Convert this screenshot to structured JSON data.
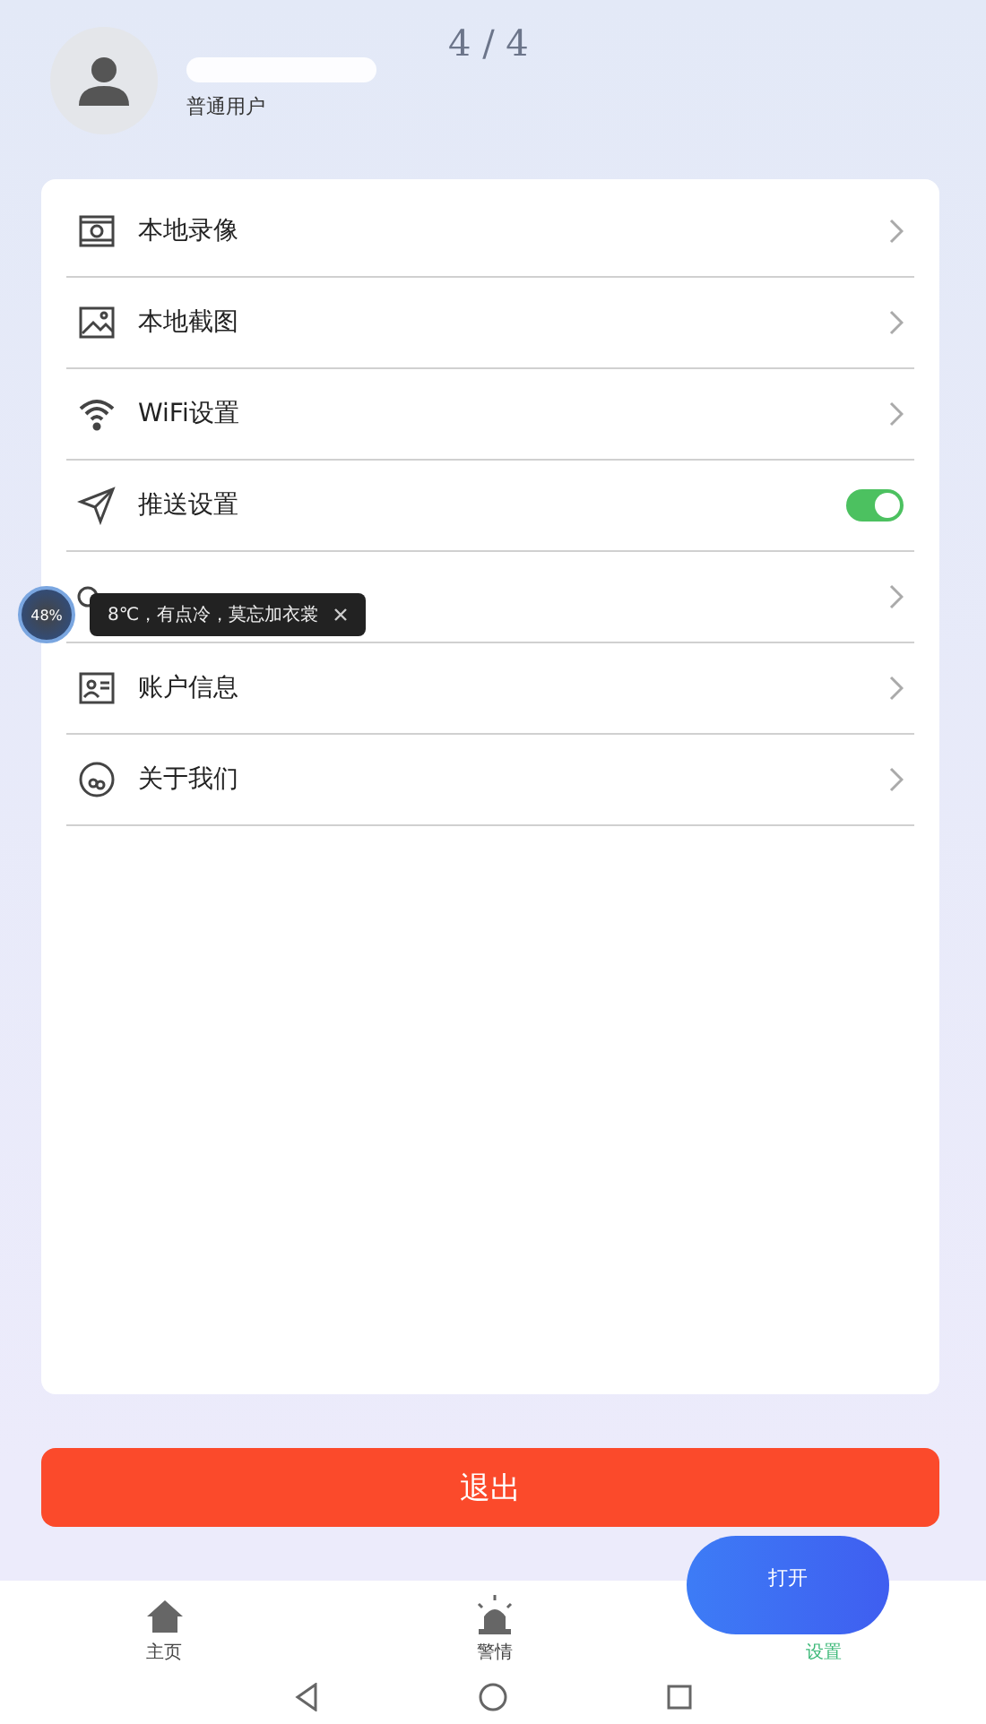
{
  "page_counter": "4 / 4",
  "profile": {
    "role": "普通用户"
  },
  "menu": [
    {
      "kind": "link",
      "label": "本地录像"
    },
    {
      "kind": "link",
      "label": "本地截图"
    },
    {
      "kind": "link",
      "label": "WiFi设置"
    },
    {
      "kind": "toggle",
      "label": "推送设置",
      "on": true
    },
    {
      "kind": "link"
    },
    {
      "kind": "link",
      "label": "账户信息"
    },
    {
      "kind": "link",
      "label": "关于我们"
    }
  ],
  "logout_button": "退出",
  "float_ball": {
    "percent": "48%",
    "tip": "8℃，有点冷，莫忘加衣裳"
  },
  "fab": "打开",
  "tabs": [
    {
      "label": "主页",
      "selected": false
    },
    {
      "label": "警情",
      "selected": false
    },
    {
      "label": "设置",
      "selected": true
    }
  ]
}
